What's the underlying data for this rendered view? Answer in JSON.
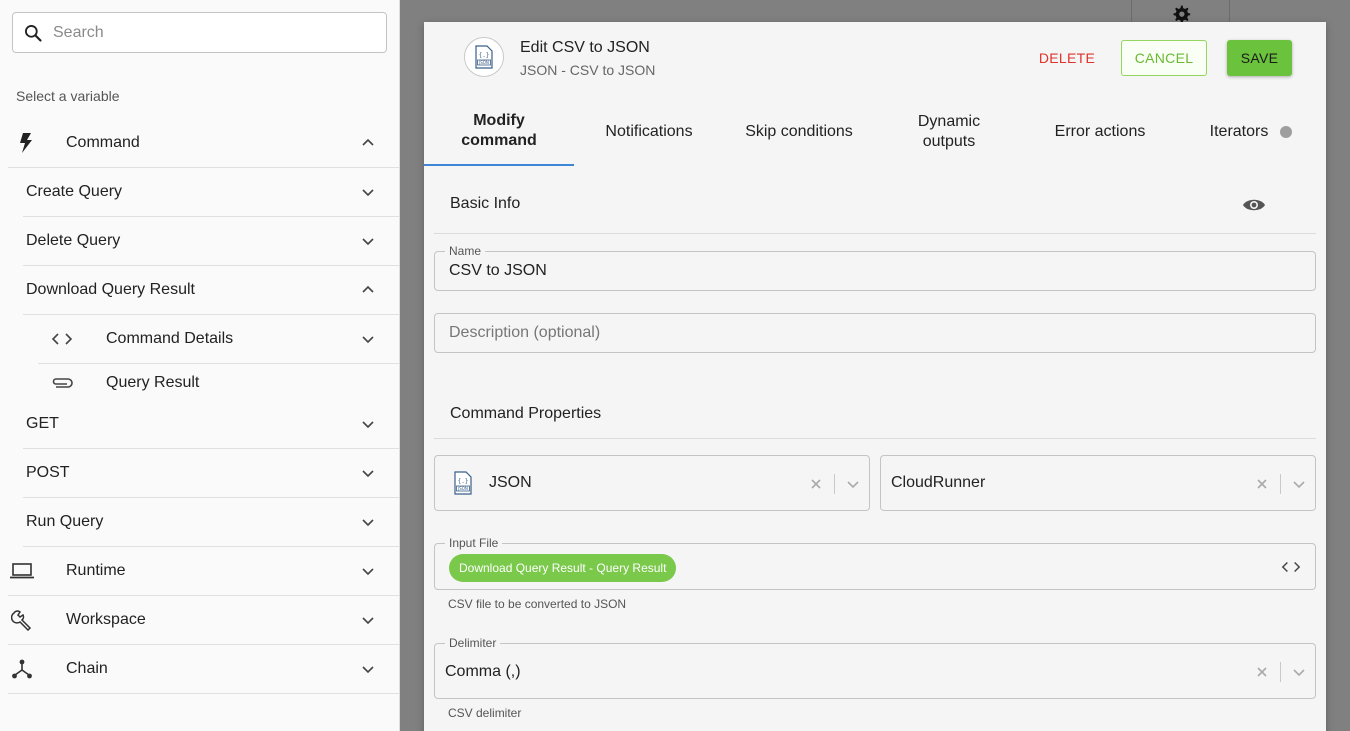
{
  "sidebar": {
    "search_placeholder": "Search",
    "select_label": "Select a variable",
    "items": [
      {
        "label": "Command"
      },
      {
        "label": "Create Query"
      },
      {
        "label": "Delete Query"
      },
      {
        "label": "Download Query Result"
      },
      {
        "label": "Command Details"
      },
      {
        "label": "Query Result"
      },
      {
        "label": "GET"
      },
      {
        "label": "POST"
      },
      {
        "label": "Run Query"
      },
      {
        "label": "Runtime"
      },
      {
        "label": "Workspace"
      },
      {
        "label": "Chain"
      }
    ]
  },
  "modal": {
    "title": "Edit CSV to JSON",
    "subtitle": "JSON - CSV to JSON",
    "delete_label": "DELETE",
    "cancel_label": "CANCEL",
    "save_label": "SAVE",
    "tabs": [
      {
        "label": "Modify command"
      },
      {
        "label": "Notifications"
      },
      {
        "label": "Skip conditions"
      },
      {
        "label": "Dynamic outputs"
      },
      {
        "label": "Error actions"
      },
      {
        "label": "Iterators"
      }
    ],
    "basic_info_title": "Basic Info",
    "name_label": "Name",
    "name_value": "CSV to JSON",
    "description_placeholder": "Description (optional)",
    "command_properties_title": "Command Properties",
    "integration_value": "JSON",
    "runner_value": "CloudRunner",
    "input_file_label": "Input File",
    "input_file_chip": "Download Query Result - Query Result",
    "input_file_helper": "CSV file to be converted to JSON",
    "delimiter_label": "Delimiter",
    "delimiter_value": "Comma (,)",
    "delimiter_helper": "CSV delimiter"
  },
  "colors": {
    "accent_blue": "#3f85d6",
    "save_green": "#6bc23c",
    "delete_red": "#e0332b",
    "chip_green": "#7ac94a"
  }
}
